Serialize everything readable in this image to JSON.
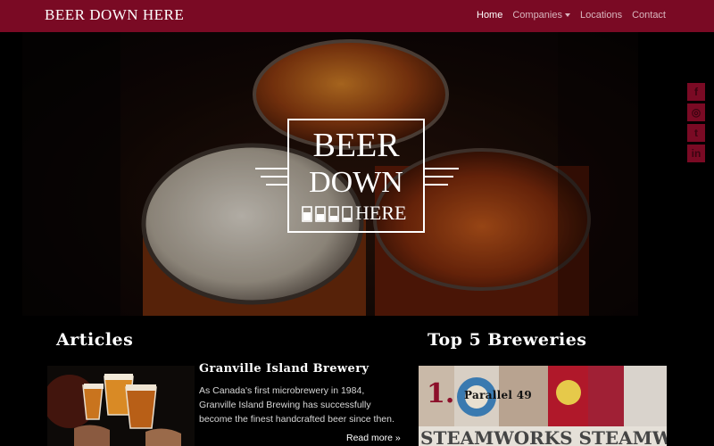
{
  "navbar": {
    "brand": "BEER DOWN HERE",
    "items": [
      {
        "label": "Home",
        "active": true
      },
      {
        "label": "Companies",
        "active": false,
        "dropdown": true
      },
      {
        "label": "Locations",
        "active": false
      },
      {
        "label": "Contact",
        "active": false
      }
    ]
  },
  "hero": {
    "logo": {
      "line1": "BEER",
      "line2": "DOWN",
      "line3": "HERE"
    }
  },
  "social": [
    {
      "icon": "facebook-icon",
      "glyph": "f"
    },
    {
      "icon": "instagram-icon",
      "glyph": "◎"
    },
    {
      "icon": "twitter-icon",
      "glyph": "t"
    },
    {
      "icon": "linkedin-icon",
      "glyph": "in"
    }
  ],
  "articles": {
    "title": "Articles",
    "items": [
      {
        "heading": "Granville Island Brewery",
        "description": "As Canada's first microbrewery in 1984, Granville Island Brewing has successfully become the finest handcrafted beer since then.",
        "read_more": "Read more »"
      }
    ]
  },
  "breweries": {
    "title": "Top 5 Breweries",
    "items": [
      {
        "rank": "1.",
        "name": "Parallel 49"
      }
    ]
  },
  "colors": {
    "accent": "#7a0a24",
    "background": "#000000",
    "rank": "#8c0f2a"
  }
}
